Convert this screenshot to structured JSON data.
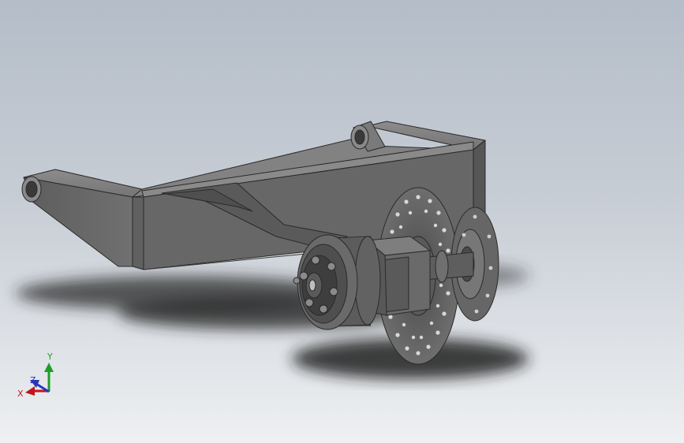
{
  "viewport": {
    "background_top": "#b4bdc8",
    "background_bottom": "#eef0f2"
  },
  "model": {
    "body_color": "#6a6a6a",
    "edge_color": "#2a2a2a",
    "shadow_color": "#2c2c2c"
  },
  "triad": {
    "x_label": "X",
    "y_label": "Y",
    "z_label": "Z",
    "x_color": "#c0151c",
    "y_color": "#1d9e2a",
    "z_color": "#2a36b8"
  }
}
